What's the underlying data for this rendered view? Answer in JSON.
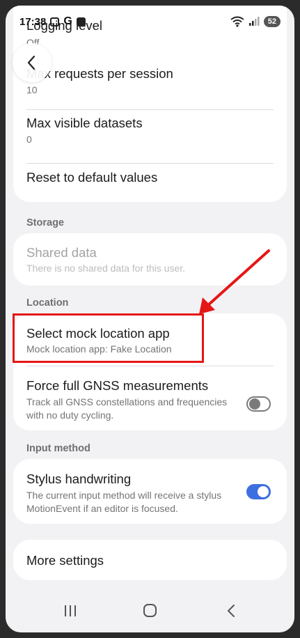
{
  "status_bar": {
    "time": "17:38",
    "g_label": "G",
    "battery": "52"
  },
  "developer_settings": {
    "logging": {
      "title": "Logging level",
      "value": "Off"
    },
    "max_requests": {
      "title": "Max requests per session",
      "value": "10"
    },
    "max_datasets": {
      "title": "Max visible datasets",
      "value": "0"
    },
    "reset": {
      "title": "Reset to default values"
    }
  },
  "storage": {
    "header": "Storage",
    "shared_data": {
      "title": "Shared data",
      "subtitle": "There is no shared data for this user."
    }
  },
  "location": {
    "header": "Location",
    "mock_app": {
      "title": "Select mock location app",
      "subtitle": "Mock location app: Fake Location"
    },
    "gnss": {
      "title": "Force full GNSS measurements",
      "subtitle": "Track all GNSS constellations and frequencies with no duty cycling.",
      "enabled": false
    }
  },
  "input_method": {
    "header": "Input method",
    "stylus": {
      "title": "Stylus handwriting",
      "subtitle": "The current input method will receive a stylus MotionEvent if an editor is focused.",
      "enabled": true
    }
  },
  "more_settings": {
    "title": "More settings"
  },
  "icons": {
    "back": "chevron-left-icon",
    "recents": "recents-icon",
    "home": "home-icon",
    "nav_back": "nav-back-icon",
    "wifi": "wifi-icon",
    "signal": "signal-icon"
  },
  "colors": {
    "accent": "#3e6fe0",
    "annotation": "#e51616",
    "background": "#f2f2f4"
  }
}
